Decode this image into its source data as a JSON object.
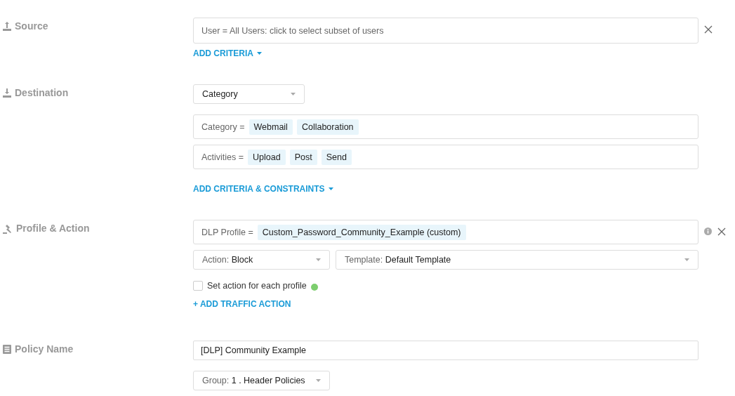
{
  "source": {
    "title": "Source",
    "criteria": "User = All Users: click to select subset of users",
    "add_link": "ADD CRITERIA"
  },
  "destination": {
    "title": "Destination",
    "type_select": "Category",
    "filters": [
      {
        "label": "Category =",
        "tags": [
          "Webmail",
          "Collaboration"
        ]
      },
      {
        "label": "Activities =",
        "tags": [
          "Upload",
          "Post",
          "Send"
        ]
      }
    ],
    "add_link": "ADD CRITERIA & CONSTRAINTS"
  },
  "profile_action": {
    "title": "Profile & Action",
    "profile": {
      "label": "DLP Profile =",
      "tags": [
        "Custom_Password_Community_Example (custom)"
      ]
    },
    "action": {
      "label": "Action:",
      "value": "Block"
    },
    "template": {
      "label": "Template:",
      "value": "Default Template"
    },
    "per_profile": {
      "label": "Set action for each profile",
      "checked": false
    },
    "add_link": "+ ADD TRAFFIC ACTION"
  },
  "policy_name": {
    "title": "Policy Name",
    "value": "[DLP] Community Example",
    "group": {
      "label": "Group:",
      "value": "1 . Header Policies"
    }
  }
}
